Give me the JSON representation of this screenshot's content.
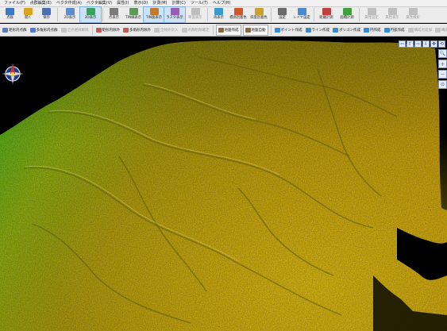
{
  "menu": [
    "ファイル(F)",
    "点群編集(E)",
    "ベクタ作成(A)",
    "ベクタ編集(V)",
    "属性(I)",
    "表示(D)",
    "計測(M)",
    "計算(C)",
    "ツール(T)",
    "ヘルプ(H)"
  ],
  "toolbar1": [
    {
      "label": "点群",
      "icon": "open-icon",
      "color": "#3a78c3"
    },
    {
      "label": "開く",
      "icon": "folder-icon",
      "color": "#d9a520"
    },
    {
      "label": "保存",
      "icon": "save-icon",
      "color": "#4a6fb5"
    },
    {
      "label": "2D表示",
      "icon": "2d-view-icon",
      "color": "#5b8cd6"
    },
    {
      "label": "3D表示",
      "icon": "3d-view-icon",
      "color": "#3aa35a",
      "active": true
    },
    {
      "label": "点表示",
      "icon": "point-display-icon",
      "color": "#7a7a7a"
    },
    {
      "label": "TIN線表示",
      "icon": "tin-line-icon",
      "color": "#5a9a5a"
    },
    {
      "label": "TIN面表示",
      "icon": "tin-surface-icon",
      "color": "#c37a2a",
      "active": true
    },
    {
      "label": "ラスタ表示",
      "icon": "raster-icon",
      "color": "#9a5ab5",
      "active": true
    },
    {
      "label": "断面表示",
      "icon": "section-view-icon",
      "color": "#888888",
      "disabled": true
    },
    {
      "label": "再表示",
      "icon": "refresh-icon",
      "color": "#3a9ad0"
    },
    {
      "label": "標高別着色",
      "icon": "elevation-color-icon",
      "color": "#d0562a"
    },
    {
      "label": "斜度別着色",
      "icon": "slope-color-icon",
      "color": "#c8a22a"
    },
    {
      "label": "設定",
      "icon": "settings-icon",
      "color": "#6a6a6a"
    },
    {
      "label": "レイヤ設定",
      "icon": "layer-icon",
      "color": "#4a8ad0"
    },
    {
      "label": "距離計測",
      "icon": "distance-icon",
      "color": "#c04040"
    },
    {
      "label": "面積計測",
      "icon": "area-icon",
      "color": "#40a040"
    },
    {
      "label": "属性設定",
      "icon": "attribute-set-icon",
      "color": "#888888",
      "disabled": true
    },
    {
      "label": "属性表示",
      "icon": "attribute-view-icon",
      "color": "#888888",
      "disabled": true
    },
    {
      "label": "属性検索",
      "icon": "attribute-search-icon",
      "color": "#888888",
      "disabled": true
    }
  ],
  "toolbar2": [
    {
      "label": "矩形内点群",
      "icon": "rect-select-icon",
      "color": "#5a7ac0"
    },
    {
      "label": "多角形内点群",
      "icon": "polygon-select-icon",
      "color": "#5a7ac0"
    },
    {
      "label": "全点選択解除",
      "icon": "deselect-icon",
      "color": "#999999",
      "disabled": true
    },
    {
      "label": "矩形内除外",
      "icon": "rect-exclude-icon",
      "color": "#c05a5a"
    },
    {
      "label": "多角形内除外",
      "icon": "polygon-exclude-icon",
      "color": "#c05a5a"
    },
    {
      "label": "全除外戻入",
      "icon": "restore-icon",
      "color": "#999999",
      "disabled": true
    },
    {
      "label": "点群削除確定",
      "icon": "delete-icon",
      "color": "#999999",
      "disabled": true
    },
    {
      "label": "地盤作成",
      "icon": "ground-create-icon",
      "color": "#8a6a3a",
      "box": true
    },
    {
      "label": "地盤自動",
      "icon": "ground-auto-icon",
      "color": "#8a6a3a",
      "box": true
    },
    {
      "label": "ポイント作成",
      "icon": "point-create-icon",
      "color": "#3a8ad0"
    },
    {
      "label": "ライン作成",
      "icon": "line-create-icon",
      "color": "#3a8ad0"
    },
    {
      "label": "ポリゴン作成",
      "icon": "polygon-create-icon",
      "color": "#3a8ad0"
    },
    {
      "label": "円作成",
      "icon": "circle-create-icon",
      "color": "#3a8ad0"
    },
    {
      "label": "円弧作成",
      "icon": "arc-create-icon",
      "color": "#3a8ad0"
    },
    {
      "label": "構成点追加",
      "icon": "vertex-add-icon",
      "color": "#999999",
      "disabled": true
    },
    {
      "label": "構成点削除",
      "icon": "vertex-delete-icon",
      "color": "#999999",
      "disabled": true
    }
  ],
  "nav_controls": [
    "⇦",
    "⇧",
    "⇨",
    "⇩",
    "✥",
    "⟲"
  ],
  "side_controls": [
    "🔍",
    "＋",
    "－",
    "⊙"
  ]
}
